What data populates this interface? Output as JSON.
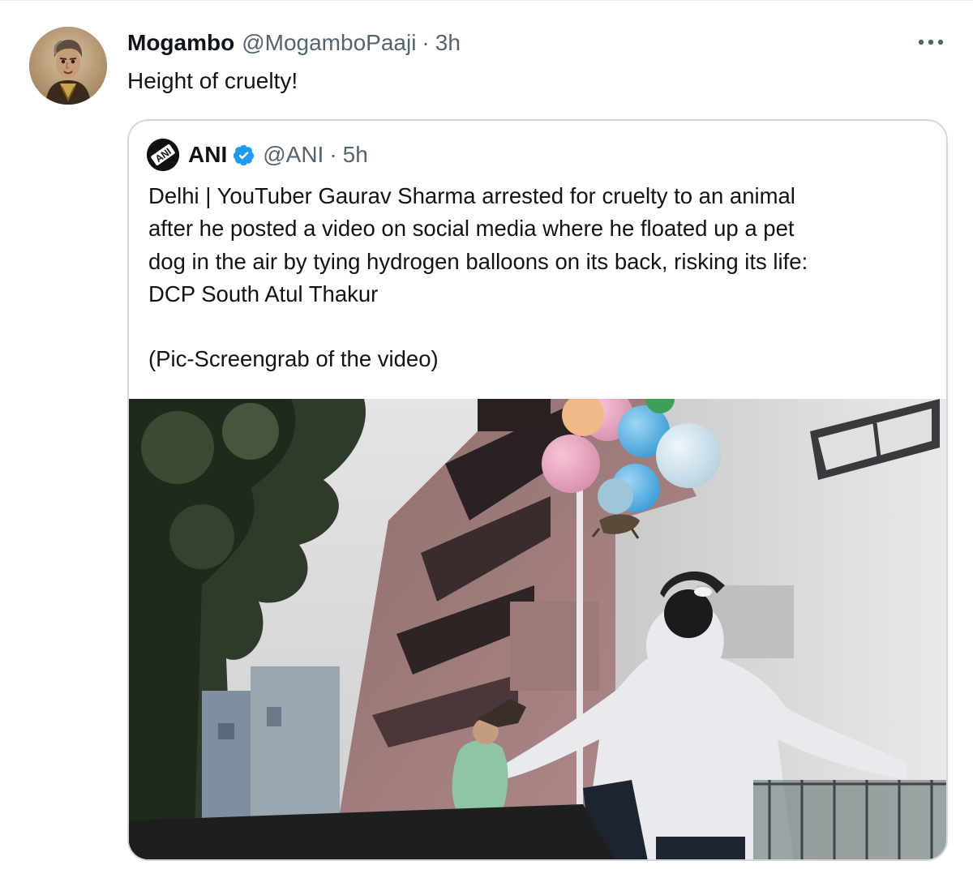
{
  "tweet": {
    "display_name": "Mogambo",
    "handle": "@MogamboPaaji",
    "separator": "·",
    "time": "3h",
    "text": "Height of cruelty!",
    "avatar_icon": "profile-avatar-icon",
    "more_icon": "more-options-icon"
  },
  "quoted_tweet": {
    "display_name": "ANI",
    "handle": "@ANI",
    "separator": "·",
    "time": "5h",
    "avatar_logo_text": "ANI",
    "verified_icon": "verified-badge-icon",
    "verified_color": "#1d9bf0",
    "text_line_1": "Delhi | YouTuber Gaurav Sharma arrested for cruelty to an animal",
    "text_line_2": "after he posted a video on social media where he floated up a pet",
    "text_line_3": "dog in the air by tying hydrogen balloons on its back, risking its life:",
    "text_line_4": "DCP South Atul Thakur",
    "text_line_5": "(Pic-Screengrab of the video)",
    "media_icon": "video-screengrab-image"
  }
}
